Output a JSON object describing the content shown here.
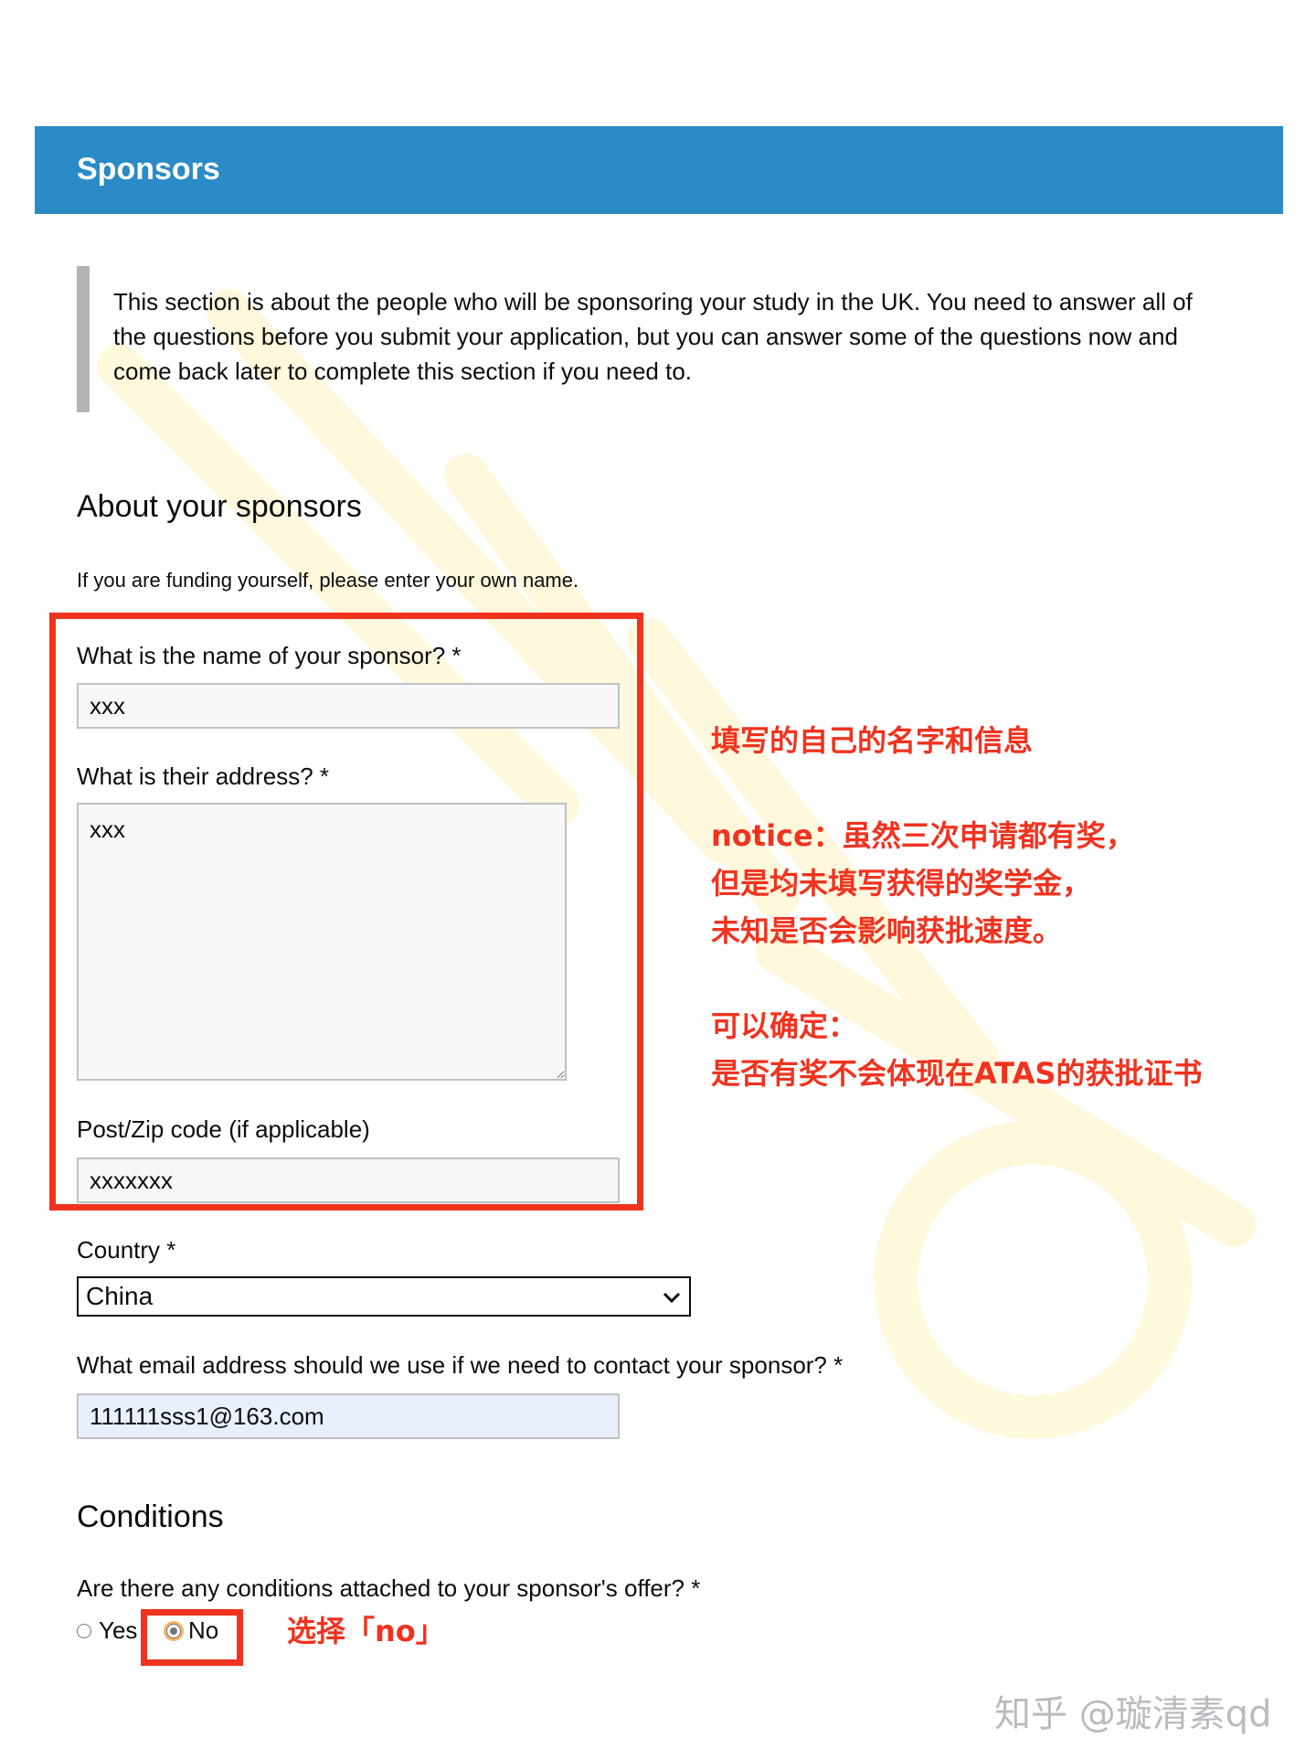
{
  "header": {
    "title": "Sponsors"
  },
  "intro": {
    "text": "This section is about the people who will be sponsoring your study in the UK. You need to answer all of the questions before you submit your application, but you can answer some of the questions now and come back later to complete this section if you need to."
  },
  "about": {
    "heading": "About your sponsors",
    "hint": "If you are funding yourself, please enter your own name."
  },
  "form": {
    "name_label": "What is the name of your sponsor? *",
    "name_value": "xxx",
    "address_label": "What is their address? *",
    "address_value": "xxx",
    "postcode_label": "Post/Zip code (if applicable)",
    "postcode_value": "xxxxxxx",
    "country_label": "Country *",
    "country_value": "China",
    "email_label": "What email address should we use if we need to contact your sponsor? *",
    "email_value": "111111sss1@163.com"
  },
  "conditions": {
    "heading": "Conditions",
    "question": "Are there any conditions attached to your sponsor's offer? *",
    "options": [
      {
        "label": "Yes",
        "selected": false
      },
      {
        "label": "No",
        "selected": true
      }
    ]
  },
  "annotations": {
    "fill_own": "填写的自己的名字和信息",
    "notice_1": "notice：虽然三次申请都有奖，",
    "notice_2": "但是均未填写获得的奖学金，",
    "notice_3": "未知是否会影响获批速度。",
    "confirm_1": "可以确定：",
    "confirm_2": "是否有奖不会体现在ATAS的获批证书",
    "choose_no": "选择「no」"
  },
  "watermark": {
    "brand": "知乎 @璇清素qd"
  },
  "colors": {
    "header_blue": "#2b8bc6",
    "annotation_red": "#f0331f",
    "inset_border": "#b1b4b6"
  }
}
